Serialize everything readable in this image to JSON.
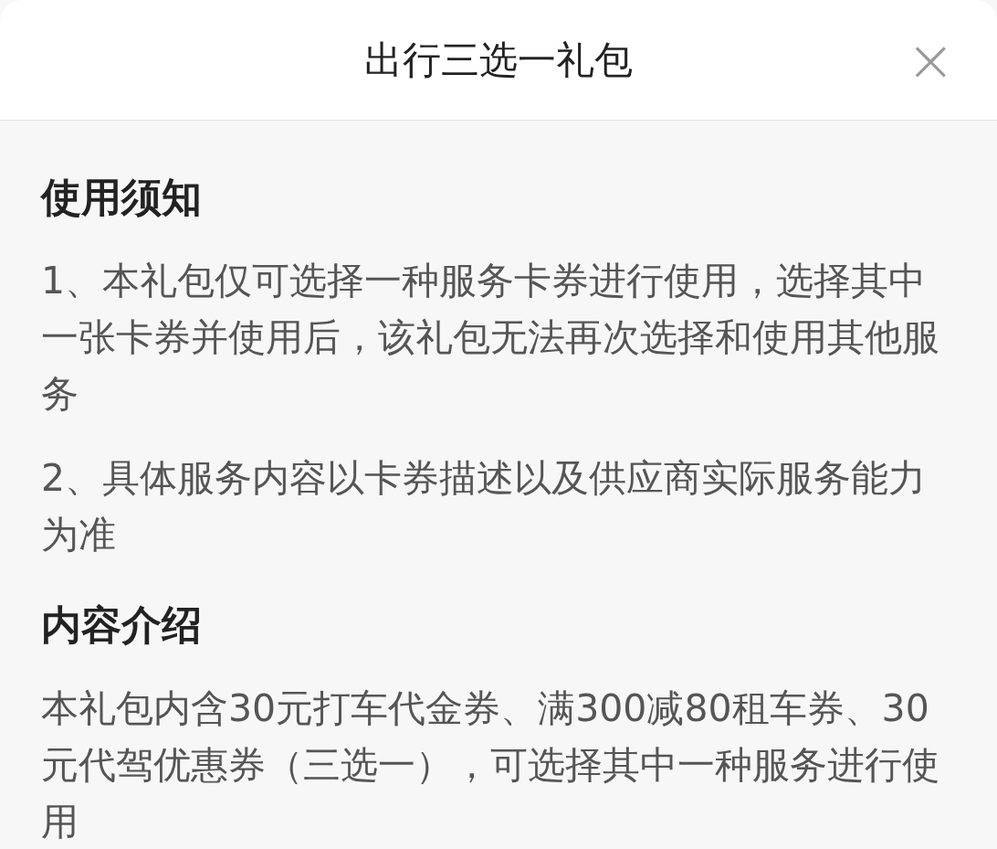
{
  "header": {
    "title": "出行三选一礼包",
    "close": "×"
  },
  "sections": [
    {
      "heading": "使用须知",
      "paragraphs": [
        "1、本礼包仅可选择一种服务卡券进行使用，选择其中一张卡券并使用后，该礼包无法再次选择和使用其他服务",
        "2、具体服务内容以卡券描述以及供应商实际服务能力为准"
      ]
    },
    {
      "heading": "内容介绍",
      "paragraphs": [
        "本礼包内含30元打车代金券、满300减80租车券、30元代驾优惠券（三选一），可选择其中一种服务进行使用"
      ]
    }
  ]
}
